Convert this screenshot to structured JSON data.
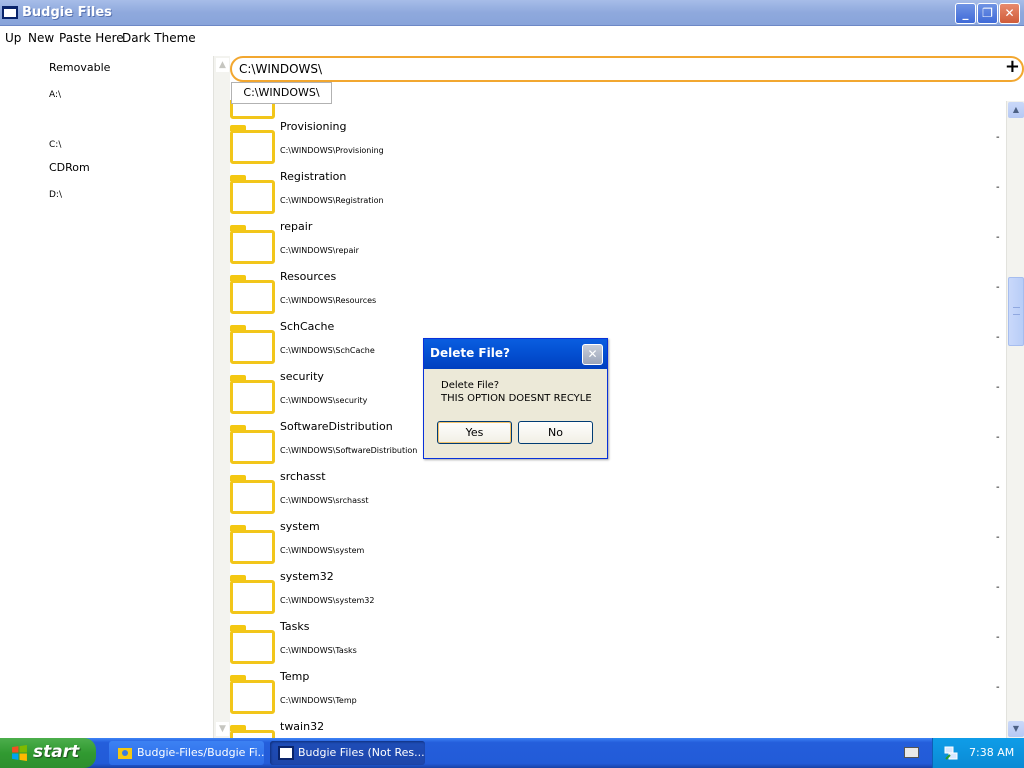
{
  "window": {
    "title": "Budgie Files"
  },
  "menu": {
    "up": "Up",
    "new": "New",
    "paste_here": "Paste Here",
    "dark_theme": "Dark Theme"
  },
  "sidebar": {
    "drives": [
      {
        "label": "Removable",
        "path": "A:\\"
      },
      {
        "label": "",
        "path": "C:\\"
      },
      {
        "label": "CDRom",
        "path": "D:\\"
      }
    ]
  },
  "pathbar": {
    "value": "C:\\WINDOWS\\",
    "suggestion": "C:\\WINDOWS\\",
    "add_icon": "plus-icon"
  },
  "files": [
    {
      "name": "Provisioning",
      "path": "C:\\WINDOWS\\Provisioning",
      "size": "-"
    },
    {
      "name": "Registration",
      "path": "C:\\WINDOWS\\Registration",
      "size": "-"
    },
    {
      "name": "repair",
      "path": "C:\\WINDOWS\\repair",
      "size": "-"
    },
    {
      "name": "Resources",
      "path": "C:\\WINDOWS\\Resources",
      "size": "-"
    },
    {
      "name": "SchCache",
      "path": "C:\\WINDOWS\\SchCache",
      "size": "-"
    },
    {
      "name": "security",
      "path": "C:\\WINDOWS\\security",
      "size": "-"
    },
    {
      "name": "SoftwareDistribution",
      "path": "C:\\WINDOWS\\SoftwareDistribution",
      "size": "-"
    },
    {
      "name": "srchasst",
      "path": "C:\\WINDOWS\\srchasst",
      "size": "-"
    },
    {
      "name": "system",
      "path": "C:\\WINDOWS\\system",
      "size": "-"
    },
    {
      "name": "system32",
      "path": "C:\\WINDOWS\\system32",
      "size": "-"
    },
    {
      "name": "Tasks",
      "path": "C:\\WINDOWS\\Tasks",
      "size": "-"
    },
    {
      "name": "Temp",
      "path": "C:\\WINDOWS\\Temp",
      "size": "-"
    },
    {
      "name": "twain32",
      "path": "",
      "size": ""
    }
  ],
  "dialog": {
    "title": "Delete File?",
    "line1": "Delete File?",
    "line2": "THIS OPTION DOESNT RECYLE",
    "yes": "Yes",
    "no": "No"
  },
  "taskbar": {
    "start": "start",
    "tasks": [
      {
        "label": "Budgie-Files/Budgie Fi...",
        "active": false
      },
      {
        "label": "Budgie Files (Not Res...",
        "active": true
      }
    ],
    "clock": "7:38 AM"
  },
  "colors": {
    "folder": "#f2c61a",
    "pathbar_border": "#f2a730",
    "titlebar": "#8fa9dd",
    "dialog_title": "#0452d4",
    "taskbar": "#245edb",
    "start_button": "#319a31"
  }
}
